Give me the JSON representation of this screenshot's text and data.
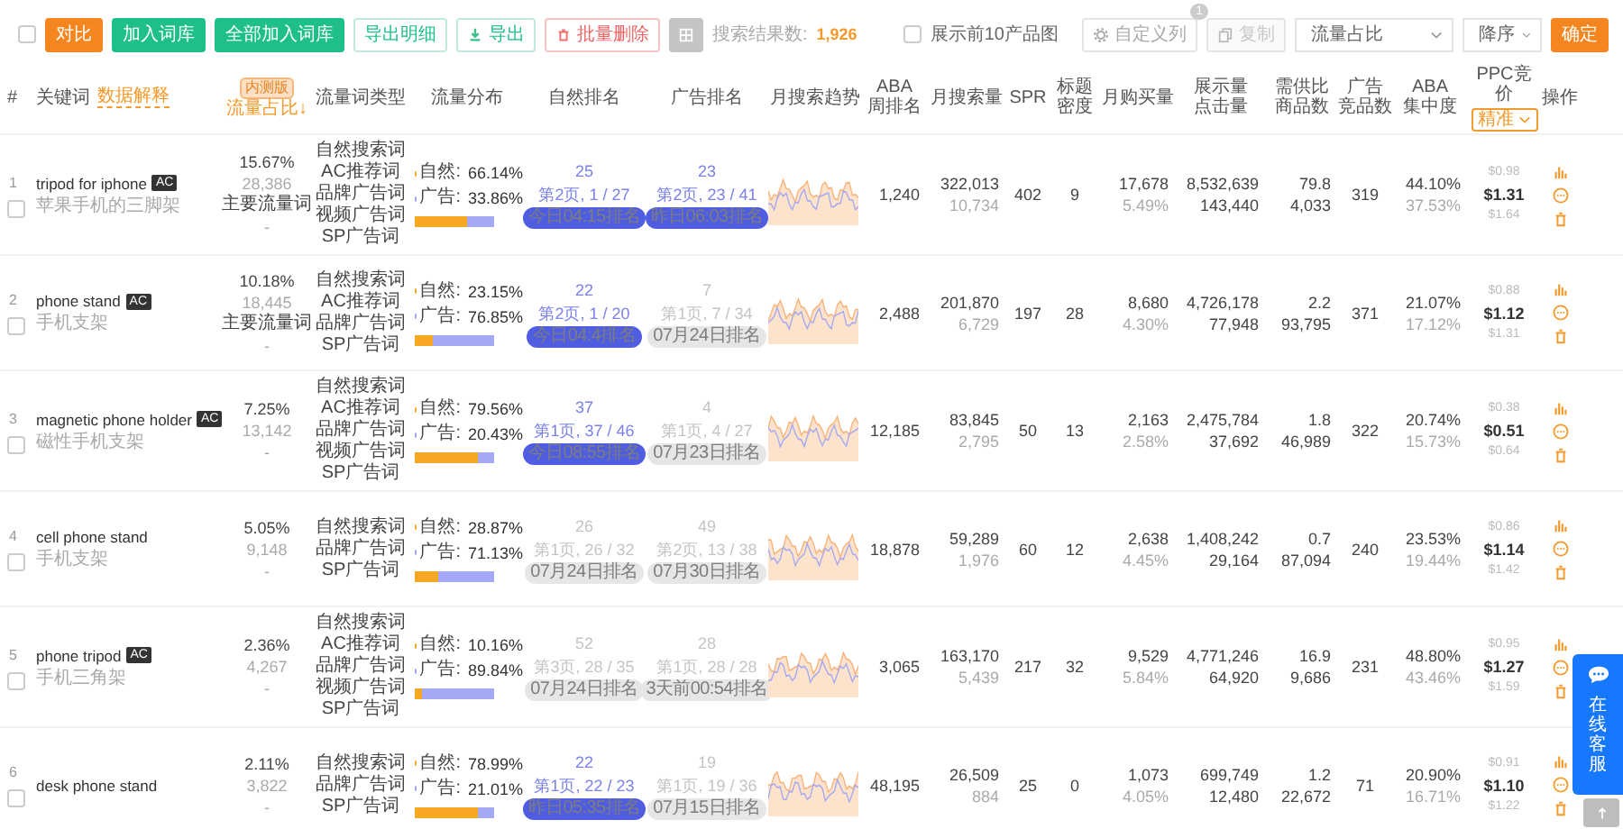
{
  "toolbar": {
    "select_all": {
      "checked": false
    },
    "buttons": [
      {
        "label": "对比",
        "kind": "primary"
      },
      {
        "label": "加入词库",
        "kind": "success"
      },
      {
        "label": "全部加入词库",
        "kind": "success"
      },
      {
        "label": "导出明细",
        "kind": "outline"
      },
      {
        "label": "导出",
        "kind": "export"
      },
      {
        "label": "批量删除",
        "kind": "danger"
      },
      {
        "kind": "grey"
      }
    ],
    "result_label": "搜索结果数:",
    "result_count": "1,926",
    "show_images": {
      "label": "展示前10产品图",
      "checked": false
    },
    "custom_columns": {
      "label": "自定义列",
      "badge": "1"
    },
    "copy": {
      "label": "复制",
      "disabled": true
    },
    "sort_field": "流量占比",
    "sort_order": "降序",
    "confirm": "确定"
  },
  "table": {
    "columns": [
      {
        "lines": [
          "#"
        ]
      },
      {
        "lines": [
          "关键词"
        ],
        "link": "数据解释"
      },
      {
        "lines": [
          "流量占比↓"
        ],
        "badge": "内测版",
        "sorted": true
      },
      {
        "lines": [
          "流量词类型"
        ]
      },
      {
        "lines": [
          "流量分布"
        ]
      },
      {
        "lines": [
          "自然排名"
        ]
      },
      {
        "lines": [
          "广告排名"
        ]
      },
      {
        "lines": [
          "月搜索趋势"
        ]
      },
      {
        "lines": [
          "ABA",
          "周排名"
        ]
      },
      {
        "lines": [
          "月搜索量"
        ]
      },
      {
        "lines": [
          "SPR"
        ]
      },
      {
        "lines": [
          "标题",
          "密度"
        ]
      },
      {
        "lines": [
          "月购买量"
        ]
      },
      {
        "lines": [
          "展示量",
          "点击量"
        ]
      },
      {
        "lines": [
          "需供比",
          "商品数"
        ]
      },
      {
        "lines": [
          "广告",
          "竞品数"
        ]
      },
      {
        "lines": [
          "ABA",
          "集中度"
        ]
      },
      {
        "lines": [
          "PPC竞价"
        ],
        "dropdown": "精准"
      },
      {
        "lines": [
          "操作"
        ]
      }
    ],
    "rows": [
      {
        "index": "1",
        "checked": false,
        "keyword": "tripod for iphone",
        "ac": "AC",
        "translation": "苹果手机的三脚架",
        "share": "15.67%",
        "share_count": "28,386",
        "tag": "主要流量词",
        "note": "-",
        "types": [
          "自然搜索词",
          "AC推荐词",
          "品牌广告词",
          "视频广告词",
          "SP广告词"
        ],
        "natural_label": "自然:",
        "natural": "66.14%",
        "ad_label": "广告:",
        "ad": "33.86%",
        "level": 0.6614,
        "natural_rank": {
          "rank": "25",
          "page": "第2页, 1 / 27",
          "time": "今日04:15排名",
          "current": true
        },
        "ad_rank": {
          "rank": "23",
          "page": "第2页, 23 / 41",
          "time": "昨日06:03排名",
          "current": true
        },
        "aba": "1,240",
        "search": "322,013",
        "search_sub": "10,734",
        "spr": "402",
        "title_density": "9",
        "purchases": "17,678",
        "purchase_rate": "5.49%",
        "impressions": "8,532,639",
        "clicks": "143,440",
        "ratio": "79.8",
        "products": "4,033",
        "ad_products": "319",
        "concentration": "44.10%",
        "concentration_sub": "37.53%",
        "ppc_low": "$0.98",
        "ppc": "$1.31",
        "ppc_high": "$1.64"
      },
      {
        "index": "2",
        "checked": false,
        "keyword": "phone stand",
        "ac": "AC",
        "translation": "手机支架",
        "share": "10.18%",
        "share_count": "18,445",
        "tag": "主要流量词",
        "note": "-",
        "types": [
          "自然搜索词",
          "AC推荐词",
          "品牌广告词",
          "SP广告词"
        ],
        "natural_label": "自然:",
        "natural": "23.15%",
        "ad_label": "广告:",
        "ad": "76.85%",
        "level": 0.2315,
        "natural_rank": {
          "rank": "22",
          "page": "第2页, 1 / 20",
          "time": "今日04:4排名",
          "current": true
        },
        "ad_rank": {
          "rank": "7",
          "page": "第1页, 7 / 34",
          "time": "07月24日排名",
          "current": false
        },
        "aba": "2,488",
        "search": "201,870",
        "search_sub": "6,729",
        "spr": "197",
        "title_density": "28",
        "purchases": "8,680",
        "purchase_rate": "4.30%",
        "impressions": "4,726,178",
        "clicks": "77,948",
        "ratio": "2.2",
        "products": "93,795",
        "ad_products": "371",
        "concentration": "21.07%",
        "concentration_sub": "17.12%",
        "ppc_low": "$0.88",
        "ppc": "$1.12",
        "ppc_high": "$1.31"
      },
      {
        "index": "3",
        "checked": false,
        "keyword": "magnetic phone holder",
        "ac": "AC",
        "translation": "磁性手机支架",
        "share": "7.25%",
        "share_count": "13,142",
        "note": "-",
        "types": [
          "自然搜索词",
          "AC推荐词",
          "品牌广告词",
          "视频广告词",
          "SP广告词"
        ],
        "natural_label": "自然:",
        "natural": "79.56%",
        "ad_label": "广告:",
        "ad": "20.43%",
        "level": 0.7956,
        "natural_rank": {
          "rank": "37",
          "page": "第1页, 37 / 46",
          "time": "今日08:55排名",
          "current": true
        },
        "ad_rank": {
          "rank": "4",
          "page": "第1页, 4 / 27",
          "time": "07月23日排名",
          "current": false
        },
        "aba": "12,185",
        "search": "83,845",
        "search_sub": "2,795",
        "spr": "50",
        "title_density": "13",
        "purchases": "2,163",
        "purchase_rate": "2.58%",
        "impressions": "2,475,784",
        "clicks": "37,692",
        "ratio": "1.8",
        "products": "46,989",
        "ad_products": "322",
        "concentration": "20.74%",
        "concentration_sub": "15.73%",
        "ppc_low": "$0.38",
        "ppc": "$0.51",
        "ppc_high": "$0.64"
      },
      {
        "index": "4",
        "checked": false,
        "keyword": "cell phone stand",
        "translation": "手机支架",
        "share": "5.05%",
        "share_count": "9,148",
        "note": "-",
        "types": [
          "自然搜索词",
          "品牌广告词",
          "SP广告词"
        ],
        "natural_label": "自然:",
        "natural": "28.87%",
        "ad_label": "广告:",
        "ad": "71.13%",
        "level": 0.2887,
        "natural_rank": {
          "rank": "26",
          "page": "第1页, 26 / 32",
          "time": "07月24日排名",
          "current": false
        },
        "ad_rank": {
          "rank": "49",
          "page": "第2页, 13 / 38",
          "time": "07月30日排名",
          "current": false
        },
        "aba": "18,878",
        "search": "59,289",
        "search_sub": "1,976",
        "spr": "60",
        "title_density": "12",
        "purchases": "2,638",
        "purchase_rate": "4.45%",
        "impressions": "1,408,242",
        "clicks": "29,164",
        "ratio": "0.7",
        "products": "87,094",
        "ad_products": "240",
        "concentration": "23.53%",
        "concentration_sub": "19.44%",
        "ppc_low": "$0.86",
        "ppc": "$1.14",
        "ppc_high": "$1.42"
      },
      {
        "index": "5",
        "checked": false,
        "keyword": "phone tripod",
        "ac": "AC",
        "translation": "手机三角架",
        "share": "2.36%",
        "share_count": "4,267",
        "note": "-",
        "types": [
          "自然搜索词",
          "AC推荐词",
          "品牌广告词",
          "视频广告词",
          "SP广告词"
        ],
        "natural_label": "自然:",
        "natural": "10.16%",
        "ad_label": "广告:",
        "ad": "89.84%",
        "level": 0.1016,
        "natural_rank": {
          "rank": "52",
          "page": "第3页, 28 / 35",
          "time": "07月24日排名",
          "current": false
        },
        "ad_rank": {
          "rank": "28",
          "page": "第1页, 28 / 28",
          "time": "3天前00:54排名",
          "current": false
        },
        "aba": "3,065",
        "search": "163,170",
        "search_sub": "5,439",
        "spr": "217",
        "title_density": "32",
        "purchases": "9,529",
        "purchase_rate": "5.84%",
        "impressions": "4,771,246",
        "clicks": "64,920",
        "ratio": "16.9",
        "products": "9,686",
        "ad_products": "231",
        "concentration": "48.80%",
        "concentration_sub": "43.46%",
        "ppc_low": "$0.95",
        "ppc": "$1.27",
        "ppc_high": "$1.59"
      },
      {
        "index": "6",
        "checked": false,
        "keyword": "desk phone stand",
        "share": "2.11%",
        "share_count": "3,822",
        "note": "-",
        "types": [
          "自然搜索词",
          "品牌广告词",
          "SP广告词"
        ],
        "natural_label": "自然:",
        "natural": "78.99%",
        "ad_label": "广告:",
        "ad": "21.01%",
        "level": 0.7899,
        "natural_rank": {
          "rank": "22",
          "page": "第1页, 22 / 23",
          "time": "昨日05:35排名",
          "current": true
        },
        "ad_rank": {
          "rank": "19",
          "page": "第1页, 19 / 36",
          "time": "07月15日排名",
          "current": false
        },
        "aba": "48,195",
        "search": "26,509",
        "search_sub": "884",
        "spr": "25",
        "title_density": "0",
        "purchases": "1,073",
        "purchase_rate": "4.05%",
        "impressions": "699,749",
        "clicks": "12,480",
        "ratio": "1.2",
        "products": "22,672",
        "ad_products": "71",
        "concentration": "20.90%",
        "concentration_sub": "16.71%",
        "ppc_low": "$0.91",
        "ppc": "$1.10",
        "ppc_high": "$1.22"
      }
    ]
  },
  "support": {
    "label": "在线客服"
  }
}
